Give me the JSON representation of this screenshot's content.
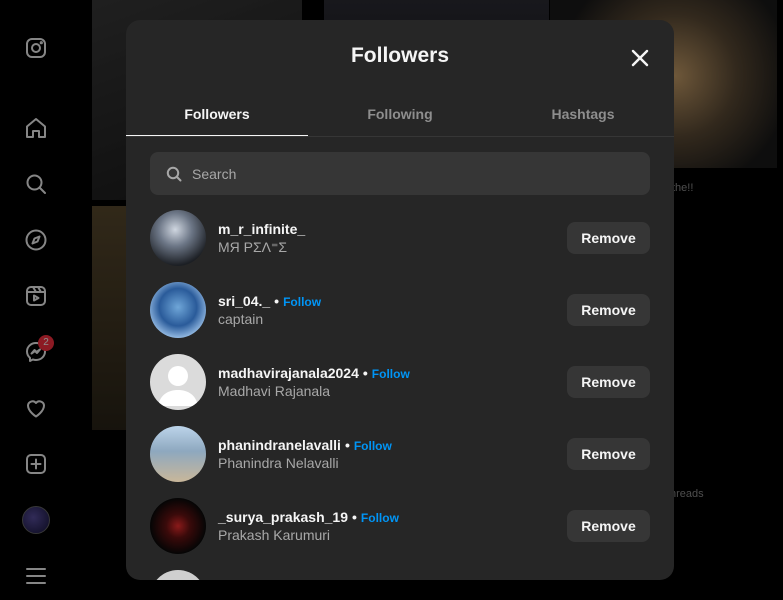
{
  "modal": {
    "title": "Followers",
    "tabs": [
      "Followers",
      "Following",
      "Hashtags"
    ],
    "search_placeholder": "Search"
  },
  "nav": {
    "messages_badge": "2"
  },
  "background": {
    "caption_fragment": "the!!",
    "threads_fragment": "hreads"
  },
  "followers": [
    {
      "username": "m_r_infinite_",
      "fullname": "МЯ ΡΣΛ⁼Σ",
      "follow": "",
      "remove": "Remove"
    },
    {
      "username": "sri_04._",
      "fullname": "captain",
      "follow": "Follow",
      "remove": "Remove"
    },
    {
      "username": "madhavirajanala2024",
      "fullname": "Madhavi Rajanala",
      "follow": "Follow",
      "remove": "Remove"
    },
    {
      "username": "phanindranelavalli",
      "fullname": "Phanindra Nelavalli",
      "follow": "Follow",
      "remove": "Remove"
    },
    {
      "username": "_surya_prakash_19",
      "fullname": "Prakash Karumuri",
      "follow": "Follow",
      "remove": "Remove"
    }
  ],
  "colors": {
    "accent": "#0095f6",
    "modal_bg": "#262626",
    "button_bg": "#363636",
    "badge": "#ff3040"
  }
}
